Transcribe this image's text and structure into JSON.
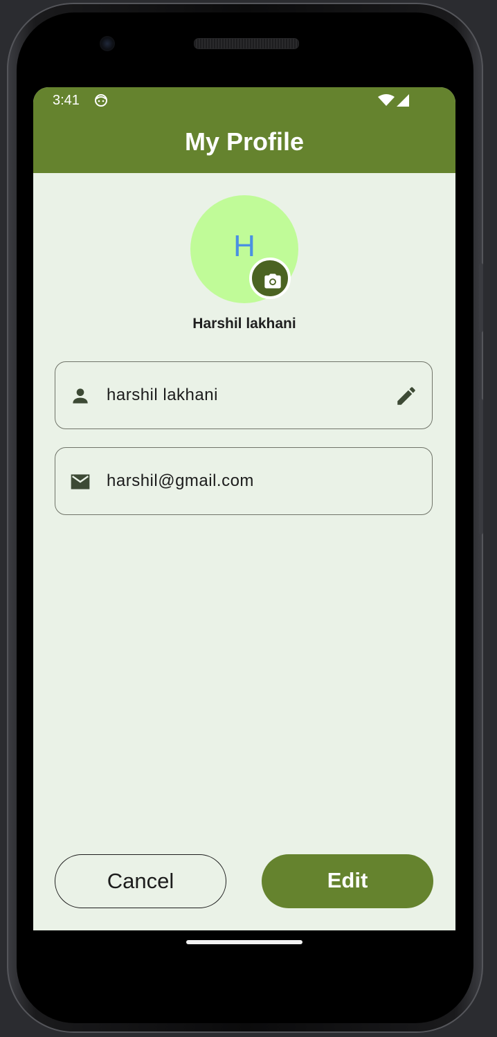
{
  "status_bar": {
    "time": "3:41",
    "face_icon": "android-face-icon",
    "wifi_icon": "wifi-icon",
    "signal_icon": "cell-signal-icon"
  },
  "app_bar": {
    "title": "My Profile",
    "background_color": "#65832e"
  },
  "profile": {
    "avatar_initial": "H",
    "avatar_bg_color": "#c0fb98",
    "avatar_text_color": "#4a90e2",
    "camera_icon": "camera-icon",
    "display_name": "Harshil lakhani"
  },
  "fields": {
    "name": {
      "icon": "person-icon",
      "value": "harshil lakhani",
      "edit_icon": "pencil-icon"
    },
    "email": {
      "icon": "mail-icon",
      "value": "harshil@gmail.com"
    }
  },
  "actions": {
    "cancel_label": "Cancel",
    "edit_label": "Edit",
    "accent_color": "#65832e"
  },
  "theme": {
    "screen_bg": "#eaf2e7"
  }
}
